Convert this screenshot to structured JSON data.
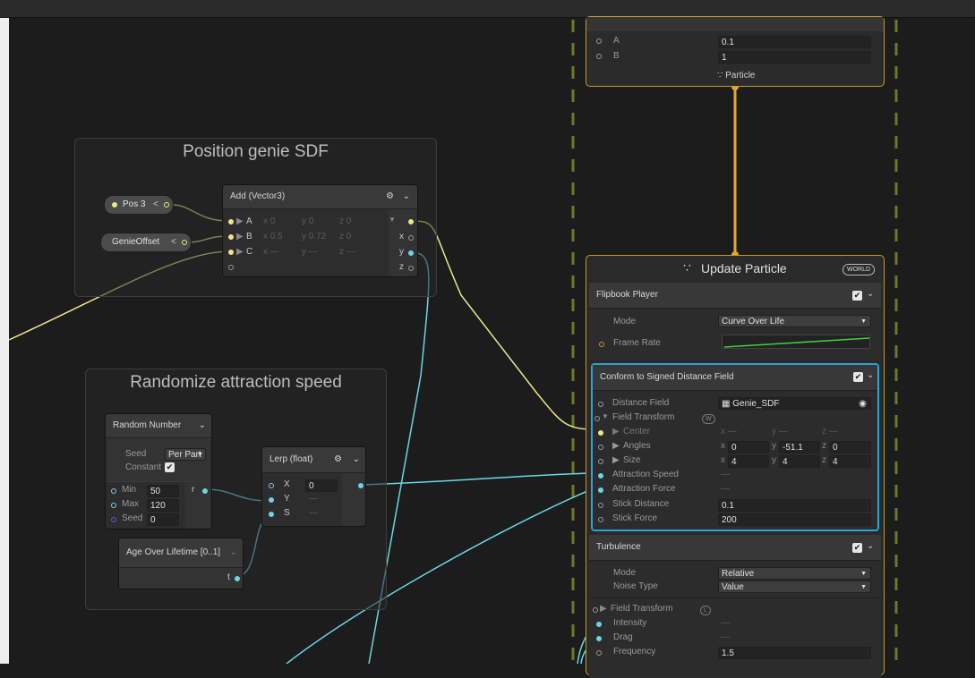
{
  "colors": {
    "accent_yellow": "#e8e98a",
    "accent_cyan": "#6ad6e6",
    "context_gold": "#c49a28",
    "selection_blue": "#2aa3d6",
    "grid_green": "#6a7a2a"
  },
  "groups": {
    "position": {
      "title": "Position genie SDF"
    },
    "randomize": {
      "title": "Randomize attraction speed"
    }
  },
  "nodes": {
    "pos3": {
      "label": "Pos 3",
      "arrow": "<"
    },
    "genie_offset": {
      "label": "GenieOffset",
      "arrow": "<"
    },
    "add": {
      "title": "Add (Vector3)",
      "rows": [
        {
          "port": "A",
          "x": "x 0",
          "y": "y 0",
          "z": "z 0"
        },
        {
          "port": "B",
          "x": "x 0.5",
          "y": "y 0.72",
          "z": "z 0"
        },
        {
          "port": "C",
          "x": "x —",
          "y": "y —",
          "z": "z —"
        }
      ],
      "outputs": [
        "x",
        "y",
        "z"
      ]
    },
    "random_number": {
      "title": "Random Number",
      "seed_label": "Seed",
      "seed_value": "Per Part",
      "constant_label": "Constant",
      "min_label": "Min",
      "min_value": "50",
      "max_label": "Max",
      "max_value": "120",
      "seed2_label": "Seed",
      "seed2_value": "0",
      "output": "r"
    },
    "lerp": {
      "title": "Lerp (float)",
      "x_label": "X",
      "x_value": "0",
      "y_label": "Y",
      "y_value": "—",
      "s_label": "S",
      "s_value": "—"
    },
    "age": {
      "title": "Age Over Lifetime [0..1]",
      "output": "t"
    }
  },
  "top_context": {
    "a_label": "A",
    "a_value": "0.1",
    "b_label": "B",
    "b_value": "1",
    "footer": "Particle"
  },
  "update_context": {
    "title": "Update Particle",
    "space_badge": "WORLD",
    "flipbook": {
      "title": "Flipbook Player",
      "mode_label": "Mode",
      "mode_value": "Curve Over Life",
      "frame_rate_label": "Frame Rate"
    },
    "conform": {
      "title": "Conform to Signed Distance Field",
      "distance_field_label": "Distance Field",
      "distance_field_value": "Genie_SDF",
      "field_transform_label": "Field Transform",
      "field_transform_badge": "W",
      "center_label": "Center",
      "center_x": "x —",
      "center_y": "y —",
      "center_z": "z —",
      "angles_label": "Angles",
      "angles_x_key": "x",
      "angles_x": "0",
      "angles_y_key": "y",
      "angles_y": "-51.1",
      "angles_z_key": "z",
      "angles_z": "0",
      "size_label": "Size",
      "size_x_key": "x",
      "size_x": "4",
      "size_y_key": "y",
      "size_y": "4",
      "size_z_key": "z",
      "size_z": "4",
      "attraction_speed_label": "Attraction Speed",
      "attraction_speed_value": "—",
      "attraction_force_label": "Attraction Force",
      "attraction_force_value": "—",
      "stick_distance_label": "Stick Distance",
      "stick_distance_value": "0.1",
      "stick_force_label": "Stick Force",
      "stick_force_value": "200"
    },
    "turbulence": {
      "title": "Turbulence",
      "mode_label": "Mode",
      "mode_value": "Relative",
      "noise_type_label": "Noise Type",
      "noise_type_value": "Value",
      "field_transform_label": "Field Transform",
      "field_transform_badge": "L",
      "intensity_label": "Intensity",
      "intensity_value": "—",
      "drag_label": "Drag",
      "drag_value": "—",
      "frequency_label": "Frequency",
      "frequency_value": "1.5"
    }
  }
}
